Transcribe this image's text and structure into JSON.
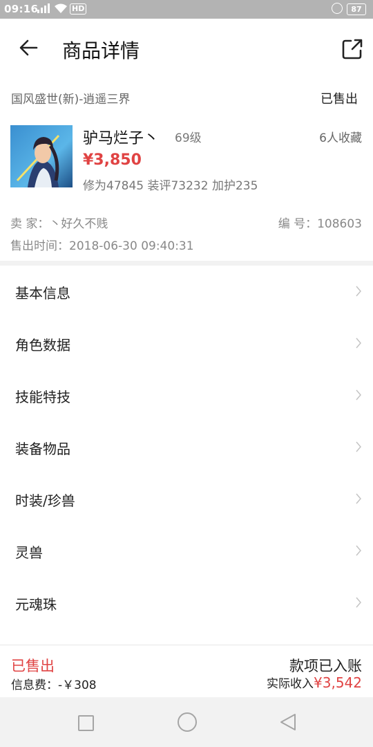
{
  "status_bar": {
    "time": "09:16",
    "hd": "HD",
    "battery": "87"
  },
  "header": {
    "title": "商品详情",
    "back_icon": "arrow-left-icon",
    "share_icon": "share-external-icon"
  },
  "product": {
    "server": "国风盛世(新)-逍遥三界",
    "status_tag": "已售出",
    "name": "驴马烂子丶",
    "level": "69级",
    "favorites": "6人收藏",
    "price": "¥3,850",
    "stats": "修为47845  装评73232  加护235",
    "seller_label": "卖  家：",
    "seller": "丶好久不贱",
    "serial_label": "编  号：",
    "serial": "108603",
    "sold_time_label": "售出时间：",
    "sold_time": "2018-06-30 09:40:31"
  },
  "menu": [
    {
      "label": "基本信息"
    },
    {
      "label": "角色数据"
    },
    {
      "label": "技能特技"
    },
    {
      "label": "装备物品"
    },
    {
      "label": "时装/珍兽"
    },
    {
      "label": "灵兽"
    },
    {
      "label": "元魂珠"
    }
  ],
  "footer": {
    "status": "已售出",
    "fee": "信息费：-￥308",
    "settled": "款项已入账",
    "income_label": "实际收入",
    "income": "¥3,542"
  },
  "colors": {
    "accent_red": "#e04343",
    "status_bar": "#b3b3b3",
    "nav_bar": "#f2f2f2"
  }
}
